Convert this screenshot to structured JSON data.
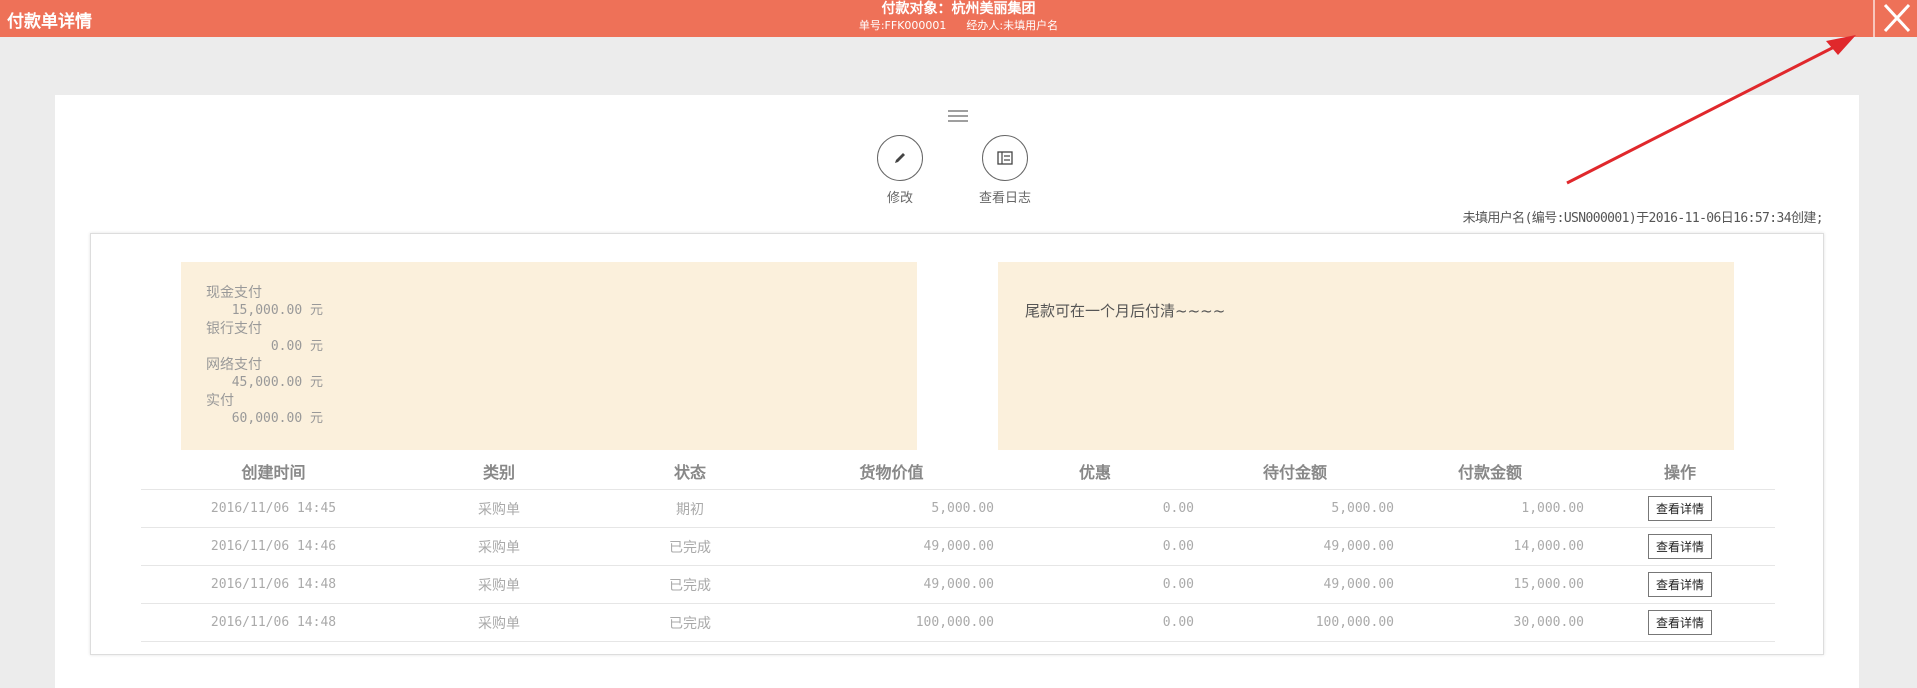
{
  "header": {
    "title": "付款单详情",
    "target_label": "付款对象：杭州美丽集团",
    "order_no": "单号:FFK000001",
    "handler": "经办人:未填用户名",
    "close_icon": "close-icon",
    "bg_color": "#ee7158"
  },
  "toolbar": {
    "menu_icon": "menu-icon",
    "edit_label": "修改",
    "edit_icon": "pencil-icon",
    "log_label": "查看日志",
    "log_icon": "log-icon"
  },
  "created_info": "未填用户名(编号:USN000001)于2016-11-06日16:57:34创建;",
  "payment_summary": [
    {
      "label": "现金支付",
      "value": "15,000.00 元"
    },
    {
      "label": "银行支付",
      "value": "0.00 元"
    },
    {
      "label": "网络支付",
      "value": "45,000.00 元"
    },
    {
      "label": "实付",
      "value": "60,000.00 元"
    }
  ],
  "remark": "尾款可在一个月后付清~~~~",
  "table": {
    "headers": [
      "创建时间",
      "类别",
      "状态",
      "货物价值",
      "优惠",
      "待付金额",
      "付款金额",
      "操作"
    ],
    "rows": [
      {
        "time": "2016/11/06 14:45",
        "type": "采购单",
        "status": "期初",
        "value": "5,000.00",
        "discount": "0.00",
        "pending": "5,000.00",
        "paid": "1,000.00",
        "action": "查看详情"
      },
      {
        "time": "2016/11/06 14:46",
        "type": "采购单",
        "status": "已完成",
        "value": "49,000.00",
        "discount": "0.00",
        "pending": "49,000.00",
        "paid": "14,000.00",
        "action": "查看详情"
      },
      {
        "time": "2016/11/06 14:48",
        "type": "采购单",
        "status": "已完成",
        "value": "49,000.00",
        "discount": "0.00",
        "pending": "49,000.00",
        "paid": "15,000.00",
        "action": "查看详情"
      },
      {
        "time": "2016/11/06 14:48",
        "type": "采购单",
        "status": "已完成",
        "value": "100,000.00",
        "discount": "0.00",
        "pending": "100,000.00",
        "paid": "30,000.00",
        "action": "查看详情"
      }
    ]
  },
  "annotation": {
    "arrow_color": "#e0282c"
  }
}
